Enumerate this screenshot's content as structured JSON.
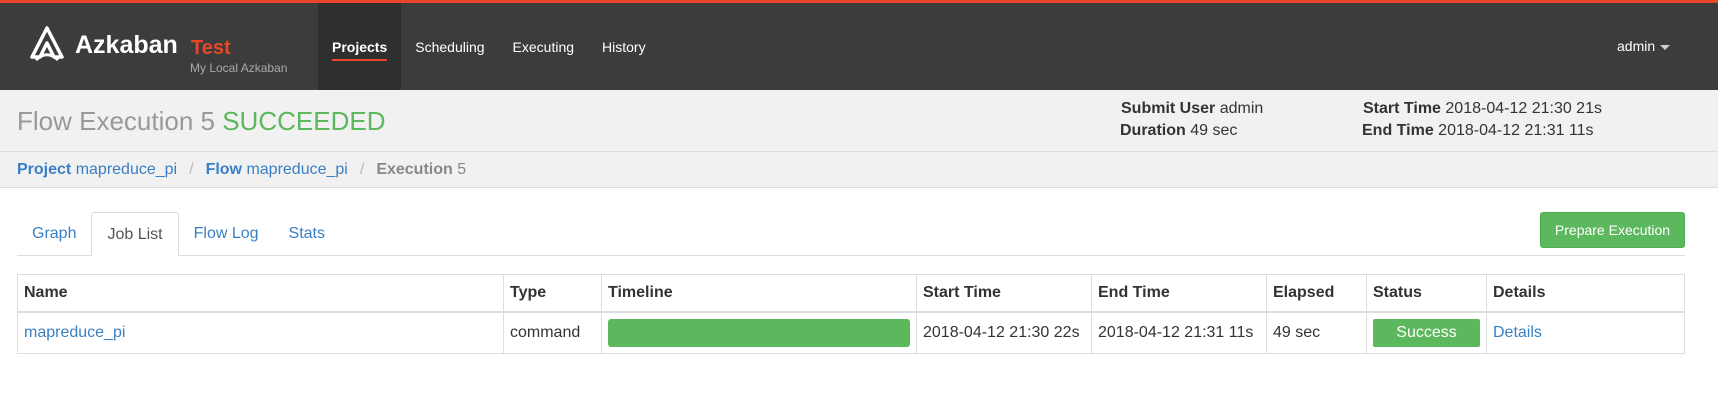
{
  "brand": {
    "name": "Azkaban",
    "env": "Test",
    "subtitle": "My Local Azkaban"
  },
  "nav": {
    "items": [
      {
        "label": "Projects",
        "active": true
      },
      {
        "label": "Scheduling",
        "active": false
      },
      {
        "label": "Executing",
        "active": false
      },
      {
        "label": "History",
        "active": false
      }
    ],
    "user": "admin"
  },
  "header": {
    "title_prefix": "Flow Execution 5",
    "status": "SUCCEEDED",
    "submit_user_label": "Submit User",
    "submit_user": "admin",
    "duration_label": "Duration",
    "duration": "49 sec",
    "start_time_label": "Start Time",
    "start_time": "2018-04-12 21:30 21s",
    "end_time_label": "End Time",
    "end_time": "2018-04-12 21:31 11s"
  },
  "breadcrumb": {
    "project_label": "Project",
    "project": "mapreduce_pi",
    "flow_label": "Flow",
    "flow": "mapreduce_pi",
    "execution_label": "Execution",
    "execution": "5",
    "separator": "/"
  },
  "tabs": [
    {
      "label": "Graph",
      "active": false
    },
    {
      "label": "Job List",
      "active": true
    },
    {
      "label": "Flow Log",
      "active": false
    },
    {
      "label": "Stats",
      "active": false
    }
  ],
  "actions": {
    "prepare_execution": "Prepare Execution"
  },
  "job_table": {
    "columns": [
      "Name",
      "Type",
      "Timeline",
      "Start Time",
      "End Time",
      "Elapsed",
      "Status",
      "Details"
    ],
    "rows": [
      {
        "name": "mapreduce_pi",
        "type": "command",
        "timeline_fraction": 1.0,
        "start_time": "2018-04-12 21:30 22s",
        "end_time": "2018-04-12 21:31 11s",
        "elapsed": "49 sec",
        "status": "Success",
        "details": "Details"
      }
    ]
  },
  "colors": {
    "accent": "#e8462a",
    "success": "#5cb85c",
    "link": "#3a7fc4",
    "topbar": "#3c3c3c"
  }
}
